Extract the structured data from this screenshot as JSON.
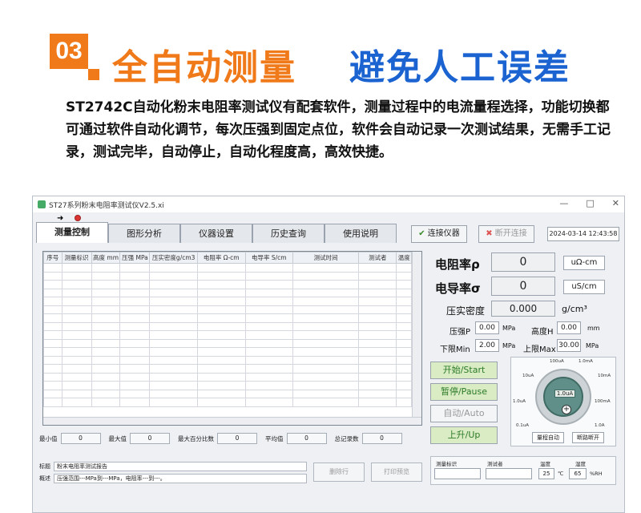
{
  "header": {
    "badge": "03",
    "title_orange": "全自动测量",
    "title_blue": "避免人工误差",
    "paragraph": "ST2742C自动化粉末电阻率测试仪有配套软件，测量过程中的电流量程选择，功能切换都可通过软件自动化调节，每次压强到固定点位，软件会自动记录一次测试结果，无需手工记录，测试完毕，自动停止，自动化程度高，高效快捷。"
  },
  "window": {
    "title": "ST27系列粉末电阻率测试仪V2.5.xi",
    "minimize": "—",
    "maximize": "□",
    "close": "✕"
  },
  "tabs": [
    "测量控制",
    "图形分析",
    "仪器设置",
    "历史查询",
    "使用说明"
  ],
  "toolbar": {
    "connect": "连接仪器",
    "disconnect": "断开连接",
    "datetime": "2024-03-14 12:43:58"
  },
  "table": {
    "headers": [
      "序号",
      "测量标识",
      "高度 mm",
      "压强 MPa",
      "压实密度g/cm3",
      "电阻率 Ω-cm",
      "电导率 S/cm",
      "测试时间",
      "测试者",
      "温度"
    ]
  },
  "stats": [
    {
      "label": "最小值",
      "value": "0"
    },
    {
      "label": "最大值",
      "value": "0"
    },
    {
      "label": "最大百分比数",
      "value": "0"
    },
    {
      "label": "平均值",
      "value": "0"
    },
    {
      "label": "总记录数",
      "value": "0"
    }
  ],
  "readings": {
    "resistivity_label": "电阻率ρ",
    "resistivity_value": "0",
    "resistivity_unit": "uΩ-cm",
    "conductivity_label": "电导率σ",
    "conductivity_value": "0",
    "conductivity_unit": "uS/cm",
    "density_label": "压实密度",
    "density_value": "0.000",
    "density_unit": "g/cm³",
    "pressure_label": "压强P",
    "pressure_value": "0.00",
    "pressure_unit": "MPa",
    "height_label": "高度H",
    "height_value": "0.00",
    "height_unit": "mm",
    "min_label": "下限Min",
    "min_value": "2.00",
    "min_unit": "MPa",
    "max_label": "上限Max",
    "max_value": "30.00",
    "max_unit": "MPa"
  },
  "controls": {
    "start": "开始/Start",
    "pause": "暂停/Pause",
    "auto": "自动/Auto",
    "up": "上升/Up"
  },
  "dial": {
    "reading": "1.0uA",
    "ranges": [
      "100uA",
      "1.0mA",
      "10mA",
      "100mA",
      "1.0A",
      "0.1uA",
      "1.0uA",
      "10uA"
    ],
    "range_auto": "量程自动",
    "disconnect_btn": "断路断开"
  },
  "bottom": {
    "title_label": "标题",
    "title_value": "粉末电阻率测试报告",
    "summary_label": "概述",
    "summary_value": "压强范围---MPa到---MPa，电阻率---到---。",
    "delete_btn": "删除行",
    "print_btn": "打印预览"
  },
  "env": {
    "mark_label": "测量标识",
    "tester_label": "测试者",
    "temp_label": "温度",
    "temp_value": "25",
    "temp_unit": "℃",
    "humidity_label": "湿度",
    "humidity_value": "65",
    "humidity_unit": "%RH"
  }
}
